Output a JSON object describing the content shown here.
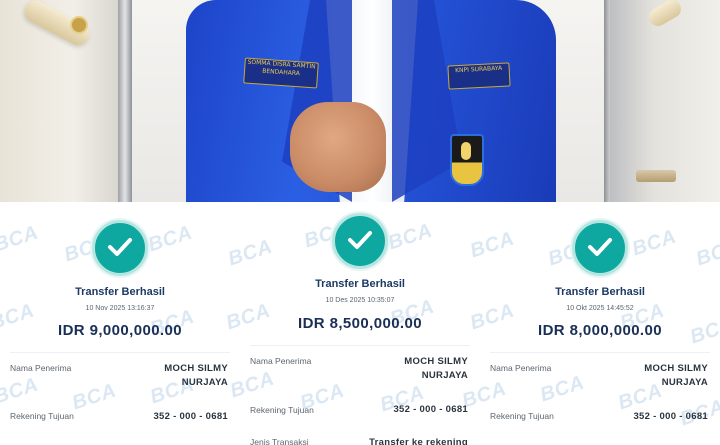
{
  "watermark": "BCA",
  "photo": {
    "badge_left": "SOMMA DISRA SAMTIN BENDAHARA",
    "badge_right": "KNPI SURABAYA"
  },
  "colors": {
    "success": "#0ea8a0",
    "jacket": "#2452d6",
    "amount_text": "#1a2f55",
    "title_text": "#1c3a64"
  },
  "receipts": [
    {
      "status_icon": "check-icon",
      "title": "Transfer Berhasil",
      "datetime": "10 Nov 2025 13:16:37",
      "amount": "IDR 9,000,000.00",
      "recipient_label": "Nama Penerima",
      "recipient_line1": "MOCH SILMY",
      "recipient_line2": "NURJAYA",
      "account_label": "Rekening Tujuan",
      "account_value": "352 - 000 - 0681"
    },
    {
      "status_icon": "check-icon",
      "title": "Transfer Berhasil",
      "datetime": "10 Des 2025 10:35:07",
      "amount": "IDR 8,500,000.00",
      "recipient_label": "Nama Penerima",
      "recipient_line1": "MOCH SILMY",
      "recipient_line2": "NURJAYA",
      "account_label": "Rekening Tujuan",
      "account_value": "352 - 000 - 0681",
      "type_label": "Jenis Transaksi",
      "type_value": "Transfer ke rekening"
    },
    {
      "status_icon": "check-icon",
      "title": "Transfer Berhasil",
      "datetime": "10 Okt 2025 14:45:52",
      "amount": "IDR 8,000,000.00",
      "recipient_label": "Nama Penerima",
      "recipient_line1": "MOCH SILMY",
      "recipient_line2": "NURJAYA",
      "account_label": "Rekening Tujuan",
      "account_value": "352 - 000 - 0681"
    }
  ]
}
